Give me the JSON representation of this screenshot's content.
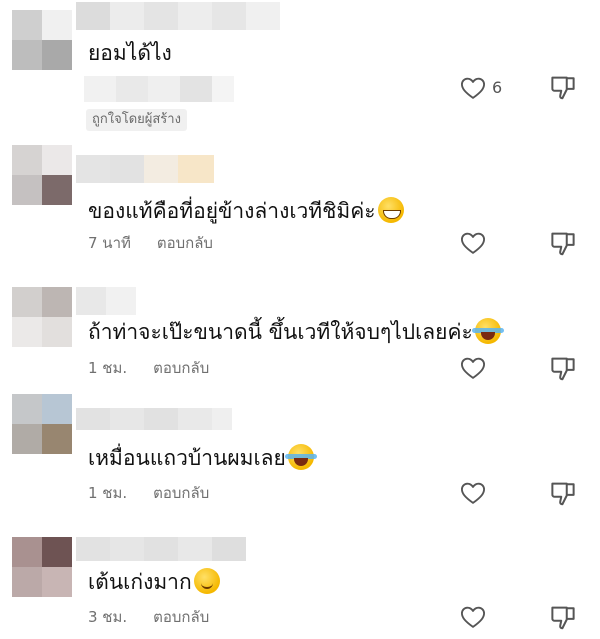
{
  "comments": [
    {
      "text": "ยอมได้ไง",
      "emoji": "",
      "time": "",
      "reply": "",
      "likes": "6",
      "creator_liked": "ถูกใจโดยผู้สร้าง"
    },
    {
      "text": "ของแท้คือที่อยู่ข้างล่างเวทีชิมิค่ะ",
      "emoji": "grinning-face-emoji",
      "time": "7 นาที",
      "reply": "ตอบกลับ",
      "likes": ""
    },
    {
      "text": "ถ้าท่าจะเป๊ะขนาดนี้ ขึ้นเวทีให้จบๆไปเลยค่ะ",
      "emoji": "tears-of-joy-emoji",
      "time": "1 ชม.",
      "reply": "ตอบกลับ",
      "likes": ""
    },
    {
      "text": "เหมื่อนแถวบ้านผมเลย",
      "emoji": "tears-of-joy-emoji",
      "time": "1 ชม.",
      "reply": "ตอบกลับ",
      "likes": ""
    },
    {
      "text": "เต้นเก่งมาก",
      "emoji": "smiling-face-emoji",
      "time": "3 ชม.",
      "reply": "ตอบกลับ",
      "likes": ""
    }
  ],
  "icons": {
    "like": "heart-outline-icon",
    "dislike": "thumbs-down-outline-icon"
  },
  "colors": {
    "text": "#111111",
    "meta": "#707070",
    "icon": "#555555",
    "badge_bg": "#f0f0f0"
  }
}
